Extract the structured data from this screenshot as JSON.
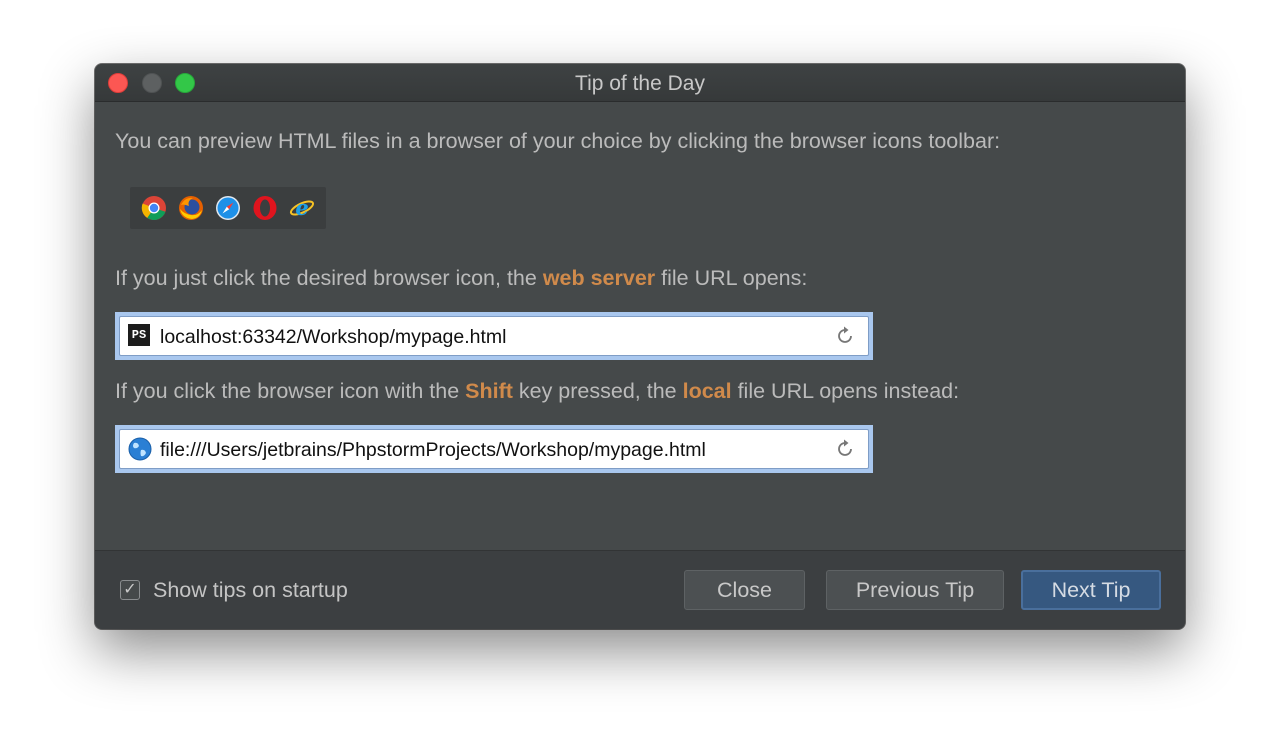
{
  "window": {
    "title": "Tip of the Day"
  },
  "tip": {
    "line1": "You can preview HTML files in a browser of your choice by clicking the browser icons toolbar:",
    "browser_icons": [
      "chrome-icon",
      "firefox-icon",
      "safari-icon",
      "opera-icon",
      "internet-explorer-icon"
    ],
    "line2": {
      "before": "If you just click the desired browser icon, the ",
      "highlight": "web server",
      "after": " file URL opens:"
    },
    "url1": {
      "icon": "phpstorm-icon",
      "icon_text": "PS",
      "text": "localhost:63342/Workshop/mypage.html"
    },
    "line3": {
      "part1": "If you click the browser icon with the ",
      "highlight1": "Shift",
      "part2": " key pressed, the ",
      "highlight2": "local",
      "part3": " file URL opens instead:"
    },
    "url2": {
      "icon": "globe-icon",
      "text": "file:///Users/jetbrains/PhpstormProjects/Workshop/mypage.html"
    }
  },
  "footer": {
    "show_tips_label": "Show tips on startup",
    "show_tips_checked": true,
    "close_label": "Close",
    "previous_label": "Previous Tip",
    "next_label": "Next Tip"
  },
  "colors": {
    "highlight": "#d08a4b",
    "dialog_bg": "#45494a",
    "default_button": "#365880"
  }
}
